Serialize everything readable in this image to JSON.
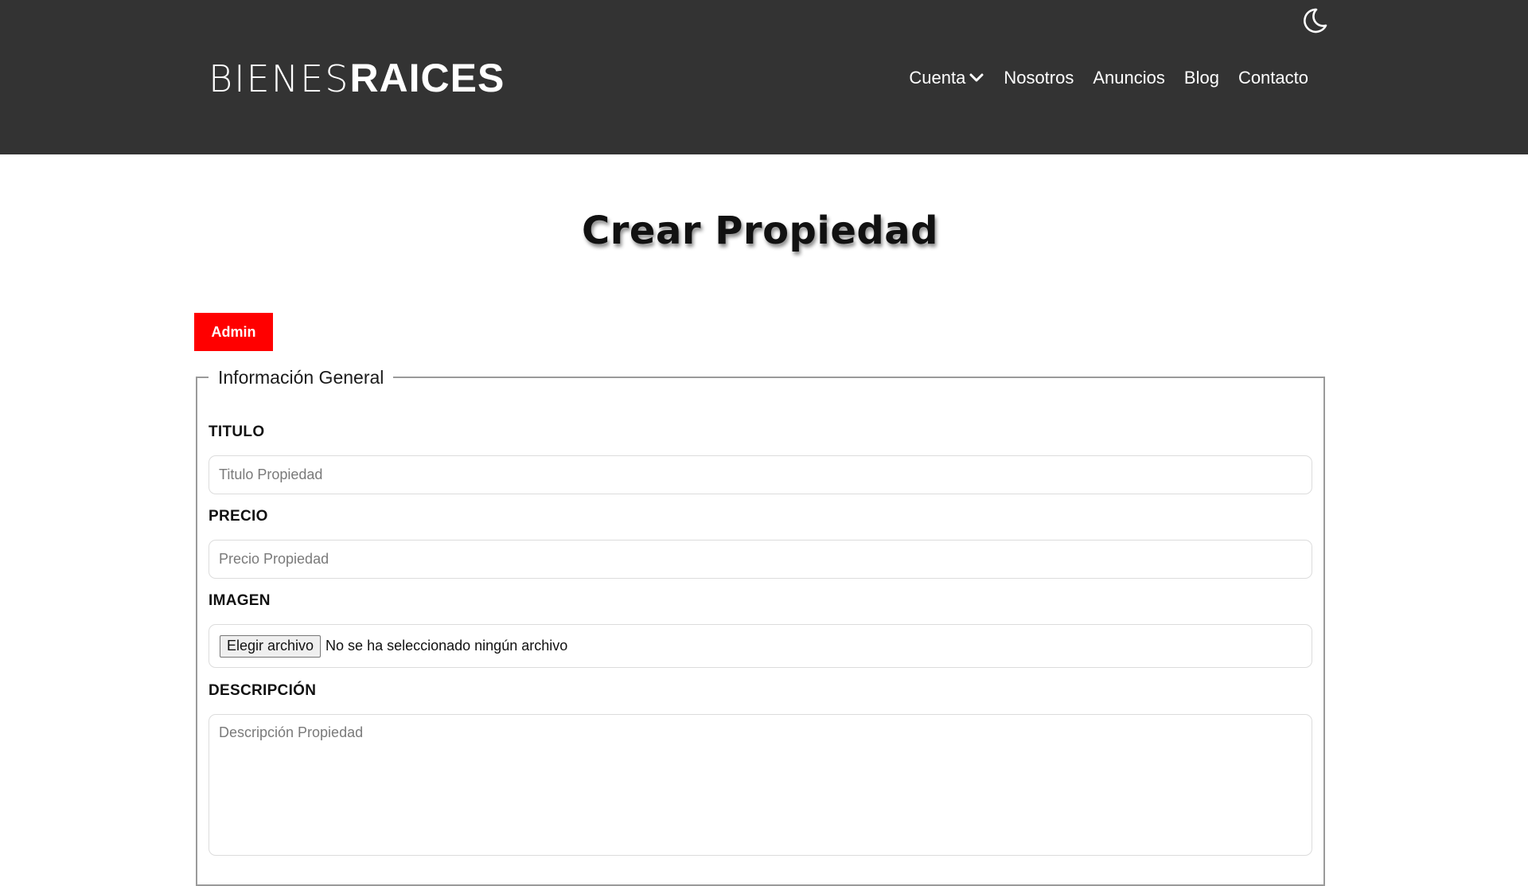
{
  "header": {
    "logo_light": "BIENES",
    "logo_bold": "RAICES",
    "theme_icon": "moon-icon",
    "nav": [
      {
        "label": "Cuenta",
        "has_dropdown": true
      },
      {
        "label": "Nosotros"
      },
      {
        "label": "Anuncios"
      },
      {
        "label": "Blog"
      },
      {
        "label": "Contacto"
      }
    ]
  },
  "main": {
    "title": "Crear Propiedad",
    "admin_button": "Admin",
    "fieldset_legend": "Información General",
    "fields": {
      "titulo": {
        "label": "TITULO",
        "placeholder": "Titulo Propiedad",
        "value": ""
      },
      "precio": {
        "label": "PRECIO",
        "placeholder": "Precio Propiedad",
        "value": ""
      },
      "imagen": {
        "label": "IMAGEN",
        "button": "Elegir archivo",
        "status": "No se ha seleccionado ningún archivo"
      },
      "descripcion": {
        "label": "DESCRIPCIÓN",
        "placeholder": "Descripción Propiedad",
        "value": ""
      }
    }
  },
  "colors": {
    "header_bg": "#333333",
    "accent_red": "#ff0000",
    "text_white": "#ffffff"
  }
}
